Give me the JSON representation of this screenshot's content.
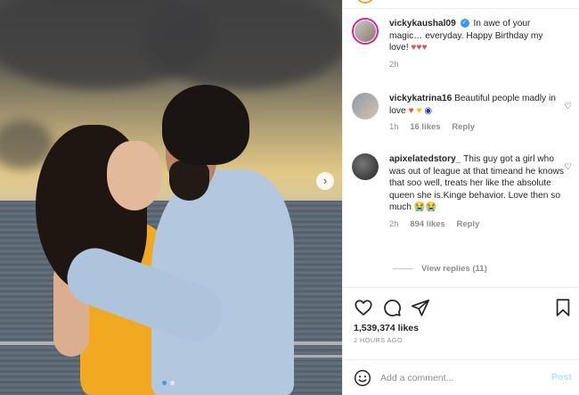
{
  "post": {
    "photo_alt": "Couple embracing on a boat at sunset",
    "carousel_next_icon": "chevron-right-icon",
    "carousel_dots": 2,
    "carousel_active": 0
  },
  "caption": {
    "username": "vickykaushal09",
    "verified": true,
    "text": "In awe of your magic… everyday. Happy Birthday my love!",
    "emojis": "♥♥♥",
    "time": "2h"
  },
  "comments": [
    {
      "username": "vickykatrina16",
      "text": "Beautiful people madly in love",
      "emojis": [
        "♥",
        "♥",
        "◉"
      ],
      "time": "1h",
      "likes": "16 likes",
      "reply_label": "Reply"
    },
    {
      "username": "apixelatedstory_",
      "text": "This guy got a girl who was out of league at that timeand he knows that soo well, treats her like the absolute queen she is.Kinge behavior. Love then so much",
      "emojis": "😭😭",
      "time": "2h",
      "likes": "894 likes",
      "reply_label": "Reply"
    }
  ],
  "view_replies": "View replies (11)",
  "actions": {
    "like_icon": "heart-icon",
    "comment_icon": "comment-icon",
    "share_icon": "share-icon",
    "save_icon": "bookmark-icon"
  },
  "likes_count": "1,539,374 likes",
  "time_ago": "2 HOURS AGO",
  "add_comment": {
    "placeholder": "Add a comment...",
    "post_label": "Post",
    "emoji_icon": "smiley-icon"
  },
  "colors": {
    "accent_blue": "#3897f0",
    "post_disabled": "#b2dffc",
    "muted_text": "#8e8e8e",
    "heart_red": "#ed4956"
  }
}
